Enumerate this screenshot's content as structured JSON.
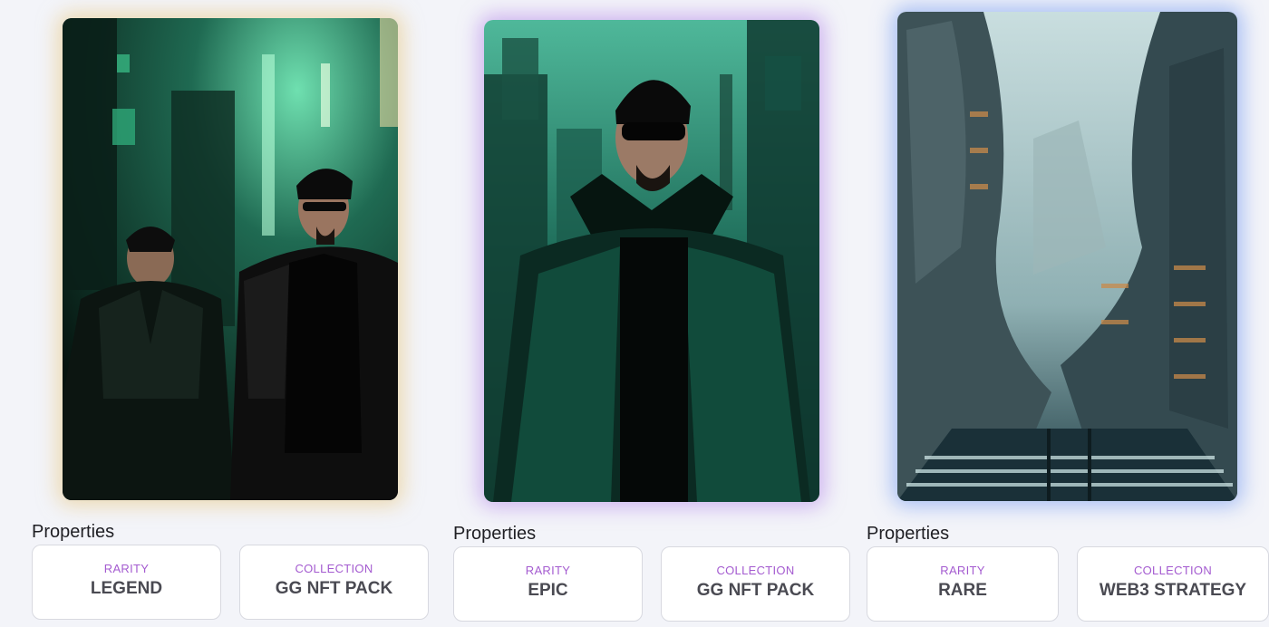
{
  "accent_color": "#a45bd0",
  "cards": [
    {
      "image_icon": "nft-artwork-two-men-leather-jackets",
      "properties_heading": "Properties",
      "properties": [
        {
          "type": "RARITY",
          "value": "LEGEND"
        },
        {
          "type": "COLLECTION",
          "value": "GG NFT PACK"
        }
      ]
    },
    {
      "image_icon": "nft-artwork-man-sunglasses-trenchcoat",
      "properties_heading": "Properties",
      "properties": [
        {
          "type": "RARITY",
          "value": "EPIC"
        },
        {
          "type": "COLLECTION",
          "value": "GG NFT PACK"
        }
      ]
    },
    {
      "image_icon": "nft-artwork-futuristic-library-city",
      "properties_heading": "Properties",
      "properties": [
        {
          "type": "RARITY",
          "value": "RARE"
        },
        {
          "type": "COLLECTION",
          "value": "WEB3 STRATEGY"
        }
      ]
    }
  ]
}
